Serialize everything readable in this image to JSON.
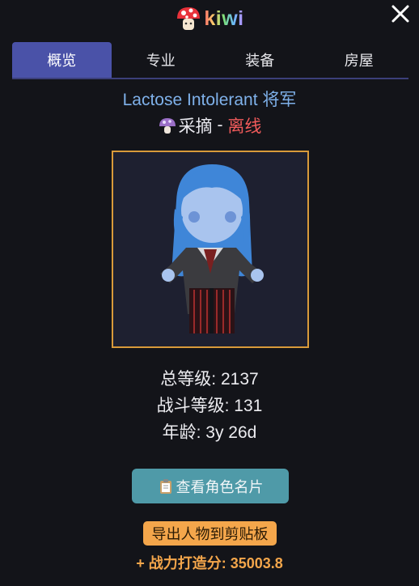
{
  "header": {
    "logo_text": "kiwi",
    "logo_icon": "mushroom-icon",
    "close_icon": "close-icon"
  },
  "tabs": [
    {
      "label": "概览",
      "active": true
    },
    {
      "label": "专业",
      "active": false
    },
    {
      "label": "装备",
      "active": false
    },
    {
      "label": "房屋",
      "active": false
    }
  ],
  "character": {
    "name": "Lactose Intolerant 将军",
    "activity_icon": "mushroom-icon",
    "activity": "采摘",
    "separator": " - ",
    "online_status": "离线",
    "total_level_label": "总等级: 2137",
    "combat_level_label": "战斗等级: 131",
    "age_label": "年龄: 3y 26d"
  },
  "actions": {
    "view_card_icon": "clipboard-icon",
    "view_card_label": "查看角色名片",
    "export_label": "导出人物到剪贴板"
  },
  "score": {
    "label": "+ 战力打造分: 35003.8"
  },
  "colors": {
    "accent_tab": "#4a52a8",
    "name_blue": "#7fb1ea",
    "offline_red": "#f25b5b",
    "frame_gold": "#d99a3a",
    "button_teal": "#4f9aa8",
    "orange": "#f4a64b"
  }
}
